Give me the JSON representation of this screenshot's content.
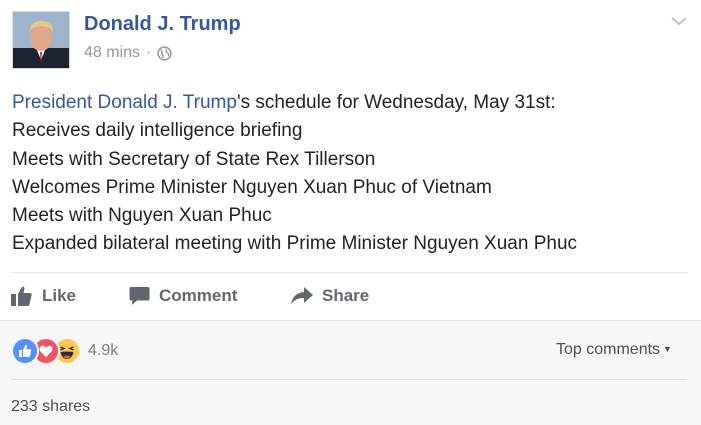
{
  "post": {
    "author": "Donald J. Trump",
    "time": "48 mins",
    "separator": "·",
    "privacy_icon": "globe-icon",
    "text_link": "President Donald J. Trump",
    "text_first_rest": "'s schedule for Wednesday, May 31st:",
    "lines": [
      "Receives daily intelligence briefing",
      "Meets with Secretary of State Rex Tillerson",
      "Welcomes Prime Minister Nguyen Xuan Phuc of Vietnam",
      "Meets with Nguyen Xuan Phuc",
      "Expanded bilateral meeting with Prime Minister Nguyen Xuan Phuc"
    ]
  },
  "actions": {
    "like": "Like",
    "comment": "Comment",
    "share": "Share"
  },
  "footer": {
    "reaction_icons": [
      "like-reaction-icon",
      "love-reaction-icon",
      "haha-reaction-icon"
    ],
    "reaction_count": "4.9k",
    "top_comments": "Top comments",
    "shares": "233 shares"
  },
  "colors": {
    "link": "#365899",
    "meta": "#90949c",
    "action": "#616770",
    "footer_bg": "#f6f7f9",
    "like": "#5890ff",
    "love": "#f25268",
    "haha": "#fcc84e"
  }
}
